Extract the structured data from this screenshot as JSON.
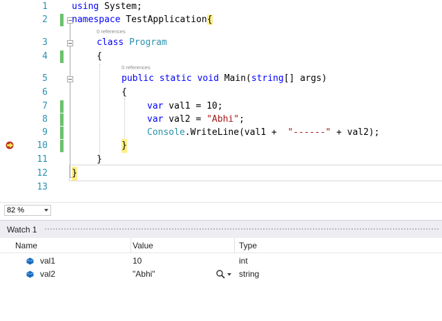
{
  "editor": {
    "line_numbers": [
      "1",
      "2",
      "3",
      "4",
      "5",
      "6",
      "7",
      "8",
      "9",
      "10",
      "11",
      "12",
      "13"
    ],
    "line1": {
      "kw": "using",
      "rest": " System;"
    },
    "line2": {
      "kw": "namespace",
      "rest": " TestApplication",
      "brace": "{"
    },
    "refs_class": "0 references",
    "line3": {
      "kw": "class",
      "type": "Program"
    },
    "line4": {
      "text": "{"
    },
    "refs_main": "0 references",
    "line5": {
      "kw1": "public",
      "kw2": "static",
      "kw3": "void",
      "name": " Main(",
      "kw4": "string",
      "rest": "[] args)"
    },
    "line6": {
      "text": "{"
    },
    "line7": {
      "kw": "var",
      "rest": " val1 = 10;"
    },
    "line8": {
      "kw": "var",
      "mid": " val2 = ",
      "str": "\"Abhi\"",
      "end": ";"
    },
    "line9": {
      "type": "Console",
      "mid": ".WriteLine(val1 +  ",
      "str": "\"------\"",
      "end": " + val2);"
    },
    "line10": {
      "text": "}"
    },
    "line11": {
      "text": "}"
    },
    "line12": {
      "text": "}"
    }
  },
  "zoom": {
    "value": "82 %"
  },
  "watch": {
    "title": "Watch 1",
    "columns": {
      "name": "Name",
      "value": "Value",
      "type": "Type"
    },
    "rows": [
      {
        "name": "val1",
        "value": "10",
        "type": "int"
      },
      {
        "name": "val2",
        "value": "\"Abhi\"",
        "type": "string"
      }
    ]
  },
  "colors": {
    "keyword": "#0000ff",
    "type": "#2b91af",
    "string": "#a31515",
    "change_bar": "#6cc26c",
    "brace_highlight": "#ffef8a"
  },
  "icons": [
    "breakpoint-arrow-icon",
    "collapse-icon",
    "variable-icon",
    "magnifier-icon",
    "dropdown-arrow-icon"
  ]
}
